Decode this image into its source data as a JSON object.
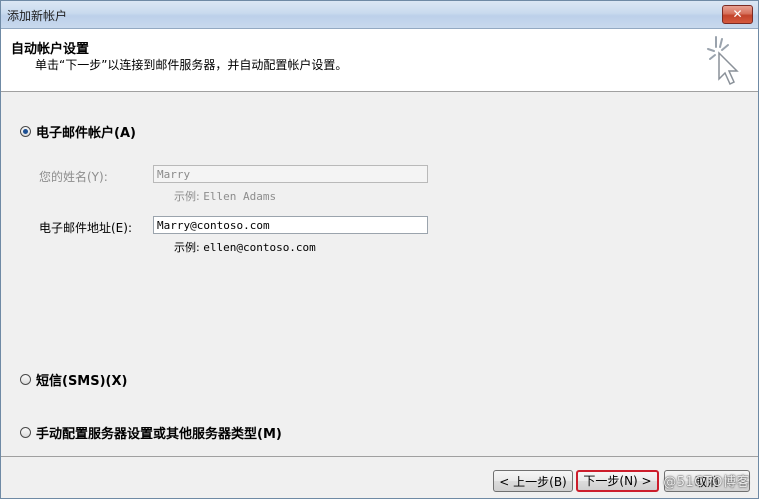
{
  "window": {
    "title": "添加新帐户",
    "close_label": "✕"
  },
  "header": {
    "title": "自动帐户设置",
    "subtitle": "单击“下一步”以连接到邮件服务器，并自动配置帐户设置。",
    "icon": "sparkle-cursor-icon"
  },
  "options": {
    "email_account": {
      "label": "电子邮件帐户(A)",
      "selected": true
    },
    "sms": {
      "label": "短信(SMS)(X)",
      "selected": false
    },
    "manual": {
      "label": "手动配置服务器设置或其他服务器类型(M)",
      "selected": false
    }
  },
  "form": {
    "name_label": "您的姓名(Y):",
    "name_value": "Marry",
    "name_example_label": "示例:",
    "name_example_value": "Ellen Adams",
    "email_label": "电子邮件地址(E):",
    "email_value": "Marry@contoso.com",
    "email_example_label": "示例:",
    "email_example_value": "ellen@contoso.com"
  },
  "buttons": {
    "back": "< 上一步(B)",
    "next": "下一步(N) >",
    "cancel": "取消"
  },
  "watermark": "@51CTO博客",
  "colors": {
    "highlight_border": "#cc1d2b",
    "radio_dot": "#1c4f92"
  }
}
